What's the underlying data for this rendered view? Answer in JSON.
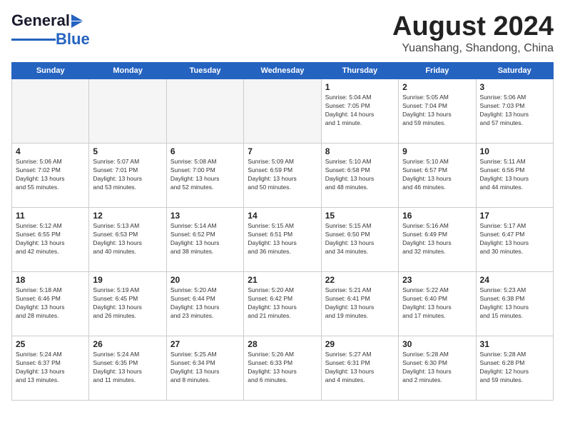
{
  "header": {
    "logo_general": "General",
    "logo_blue": "Blue",
    "month_title": "August 2024",
    "location": "Yuanshang, Shandong, China"
  },
  "days_of_week": [
    "Sunday",
    "Monday",
    "Tuesday",
    "Wednesday",
    "Thursday",
    "Friday",
    "Saturday"
  ],
  "weeks": [
    [
      {
        "day": "",
        "info": ""
      },
      {
        "day": "",
        "info": ""
      },
      {
        "day": "",
        "info": ""
      },
      {
        "day": "",
        "info": ""
      },
      {
        "day": "1",
        "info": "Sunrise: 5:04 AM\nSunset: 7:05 PM\nDaylight: 14 hours\nand 1 minute."
      },
      {
        "day": "2",
        "info": "Sunrise: 5:05 AM\nSunset: 7:04 PM\nDaylight: 13 hours\nand 59 minutes."
      },
      {
        "day": "3",
        "info": "Sunrise: 5:06 AM\nSunset: 7:03 PM\nDaylight: 13 hours\nand 57 minutes."
      }
    ],
    [
      {
        "day": "4",
        "info": "Sunrise: 5:06 AM\nSunset: 7:02 PM\nDaylight: 13 hours\nand 55 minutes."
      },
      {
        "day": "5",
        "info": "Sunrise: 5:07 AM\nSunset: 7:01 PM\nDaylight: 13 hours\nand 53 minutes."
      },
      {
        "day": "6",
        "info": "Sunrise: 5:08 AM\nSunset: 7:00 PM\nDaylight: 13 hours\nand 52 minutes."
      },
      {
        "day": "7",
        "info": "Sunrise: 5:09 AM\nSunset: 6:59 PM\nDaylight: 13 hours\nand 50 minutes."
      },
      {
        "day": "8",
        "info": "Sunrise: 5:10 AM\nSunset: 6:58 PM\nDaylight: 13 hours\nand 48 minutes."
      },
      {
        "day": "9",
        "info": "Sunrise: 5:10 AM\nSunset: 6:57 PM\nDaylight: 13 hours\nand 46 minutes."
      },
      {
        "day": "10",
        "info": "Sunrise: 5:11 AM\nSunset: 6:56 PM\nDaylight: 13 hours\nand 44 minutes."
      }
    ],
    [
      {
        "day": "11",
        "info": "Sunrise: 5:12 AM\nSunset: 6:55 PM\nDaylight: 13 hours\nand 42 minutes."
      },
      {
        "day": "12",
        "info": "Sunrise: 5:13 AM\nSunset: 6:53 PM\nDaylight: 13 hours\nand 40 minutes."
      },
      {
        "day": "13",
        "info": "Sunrise: 5:14 AM\nSunset: 6:52 PM\nDaylight: 13 hours\nand 38 minutes."
      },
      {
        "day": "14",
        "info": "Sunrise: 5:15 AM\nSunset: 6:51 PM\nDaylight: 13 hours\nand 36 minutes."
      },
      {
        "day": "15",
        "info": "Sunrise: 5:15 AM\nSunset: 6:50 PM\nDaylight: 13 hours\nand 34 minutes."
      },
      {
        "day": "16",
        "info": "Sunrise: 5:16 AM\nSunset: 6:49 PM\nDaylight: 13 hours\nand 32 minutes."
      },
      {
        "day": "17",
        "info": "Sunrise: 5:17 AM\nSunset: 6:47 PM\nDaylight: 13 hours\nand 30 minutes."
      }
    ],
    [
      {
        "day": "18",
        "info": "Sunrise: 5:18 AM\nSunset: 6:46 PM\nDaylight: 13 hours\nand 28 minutes."
      },
      {
        "day": "19",
        "info": "Sunrise: 5:19 AM\nSunset: 6:45 PM\nDaylight: 13 hours\nand 26 minutes."
      },
      {
        "day": "20",
        "info": "Sunrise: 5:20 AM\nSunset: 6:44 PM\nDaylight: 13 hours\nand 23 minutes."
      },
      {
        "day": "21",
        "info": "Sunrise: 5:20 AM\nSunset: 6:42 PM\nDaylight: 13 hours\nand 21 minutes."
      },
      {
        "day": "22",
        "info": "Sunrise: 5:21 AM\nSunset: 6:41 PM\nDaylight: 13 hours\nand 19 minutes."
      },
      {
        "day": "23",
        "info": "Sunrise: 5:22 AM\nSunset: 6:40 PM\nDaylight: 13 hours\nand 17 minutes."
      },
      {
        "day": "24",
        "info": "Sunrise: 5:23 AM\nSunset: 6:38 PM\nDaylight: 13 hours\nand 15 minutes."
      }
    ],
    [
      {
        "day": "25",
        "info": "Sunrise: 5:24 AM\nSunset: 6:37 PM\nDaylight: 13 hours\nand 13 minutes."
      },
      {
        "day": "26",
        "info": "Sunrise: 5:24 AM\nSunset: 6:35 PM\nDaylight: 13 hours\nand 11 minutes."
      },
      {
        "day": "27",
        "info": "Sunrise: 5:25 AM\nSunset: 6:34 PM\nDaylight: 13 hours\nand 8 minutes."
      },
      {
        "day": "28",
        "info": "Sunrise: 5:26 AM\nSunset: 6:33 PM\nDaylight: 13 hours\nand 6 minutes."
      },
      {
        "day": "29",
        "info": "Sunrise: 5:27 AM\nSunset: 6:31 PM\nDaylight: 13 hours\nand 4 minutes."
      },
      {
        "day": "30",
        "info": "Sunrise: 5:28 AM\nSunset: 6:30 PM\nDaylight: 13 hours\nand 2 minutes."
      },
      {
        "day": "31",
        "info": "Sunrise: 5:28 AM\nSunset: 6:28 PM\nDaylight: 12 hours\nand 59 minutes."
      }
    ]
  ]
}
